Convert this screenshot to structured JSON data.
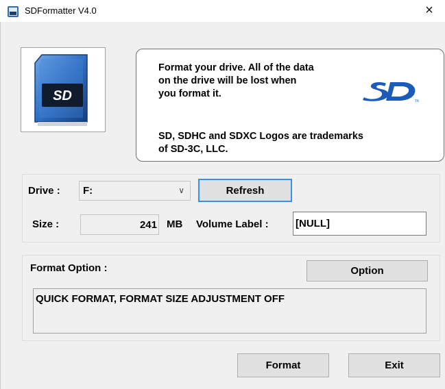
{
  "window": {
    "title": "SDFormatter V4.0",
    "close_glyph": "×",
    "icon": "sd-card-icon"
  },
  "info": {
    "message": "Format your drive. All of the data\non the drive will be lost when\nyou format it.",
    "trademark": "SD, SDHC and SDXC Logos are trademarks\nof SD-3C, LLC.",
    "logo": "sd-logo-icon"
  },
  "drive": {
    "label": "Drive :",
    "selected": "F:",
    "arrow": "∨",
    "refresh_label": "Refresh",
    "size_label": "Size :",
    "size_value": "241",
    "size_unit": "MB",
    "volume_label": "Volume Label :",
    "volume_value": "[NULL]"
  },
  "format_option": {
    "label": "Format Option :",
    "option_button": "Option",
    "status": "QUICK FORMAT, FORMAT SIZE ADJUSTMENT OFF"
  },
  "footer": {
    "format_label": "Format",
    "exit_label": "Exit"
  },
  "colors": {
    "accent": "#3b8ee0",
    "window_bg": "#f0f0f0",
    "sd_blue": "#1a5cb8"
  }
}
